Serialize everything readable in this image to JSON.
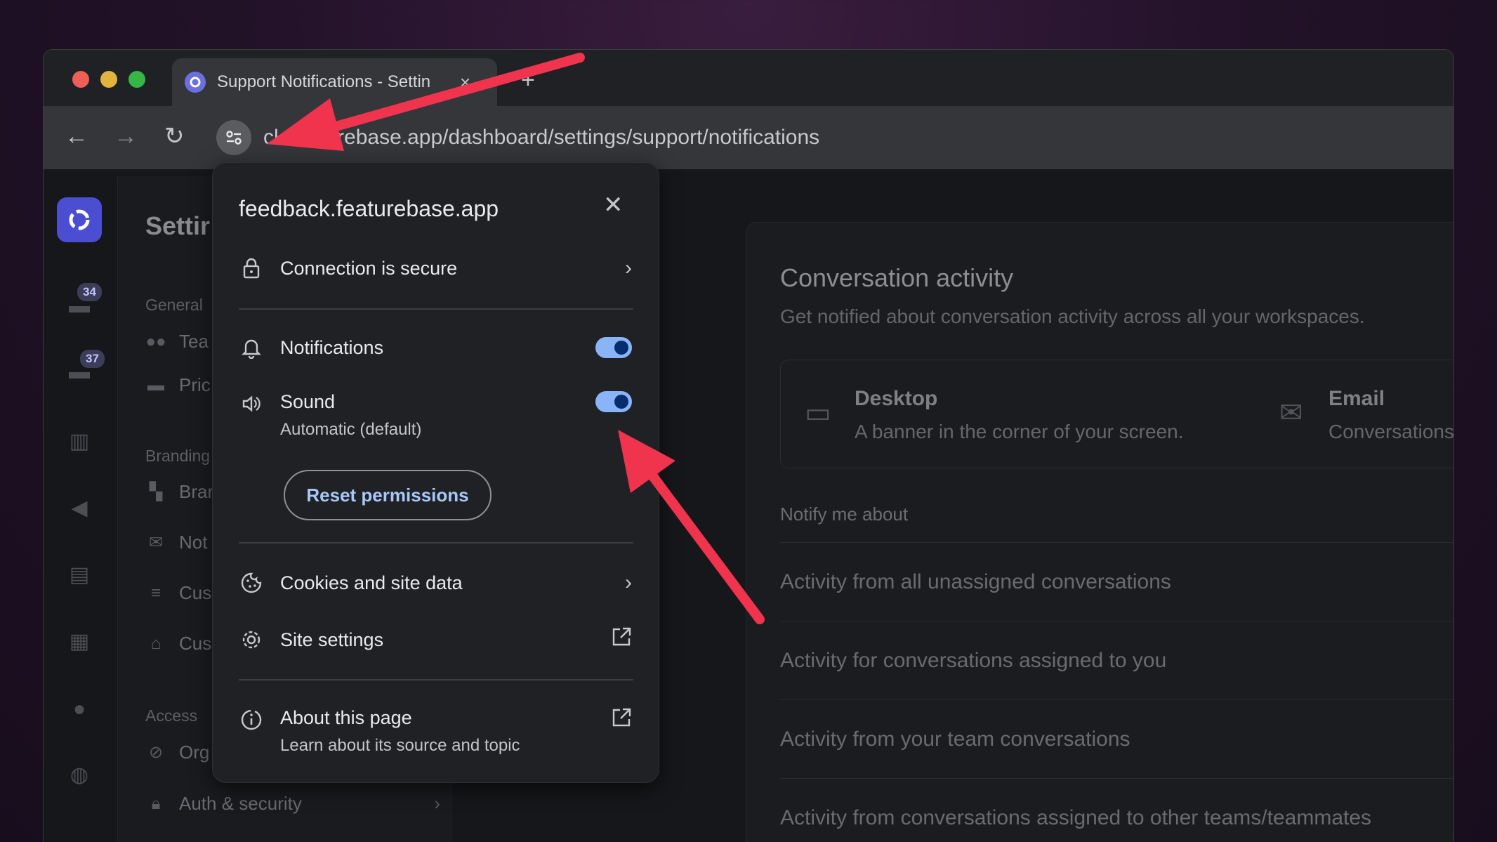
{
  "browser": {
    "tab_title": "Support Notifications - Settin",
    "tab_close": "×",
    "new_tab": "+",
    "url_visible": "ck.featurebase.app/dashboard/settings/support/notifications",
    "nav_back": "←",
    "nav_forward": "→",
    "reload": "↻"
  },
  "sidebar": {
    "badges": [
      "34",
      "37"
    ],
    "settings_title": "Settir",
    "groups": [
      {
        "label": "General",
        "items": [
          {
            "label": "Tea",
            "icon": "people-icon"
          },
          {
            "label": "Pric",
            "icon": "card-icon"
          }
        ]
      },
      {
        "label": "Branding",
        "items": [
          {
            "label": "Brar",
            "icon": "palette-icon"
          },
          {
            "label": "Not",
            "icon": "mail-icon"
          },
          {
            "label": "Cus",
            "icon": "menu-icon"
          },
          {
            "label": "Cus",
            "icon": "home-icon"
          }
        ]
      },
      {
        "label": "Access",
        "items": [
          {
            "label": "Org",
            "icon": "eye-off-icon"
          },
          {
            "label": "Auth & security",
            "icon": "lock-icon"
          }
        ]
      }
    ]
  },
  "content": {
    "title": "Conversation activity",
    "subtitle": "Get notified about conversation activity across all your workspaces.",
    "channels": [
      {
        "name": "Desktop",
        "description": "A banner in the corner of your screen.",
        "icon": "monitor-icon"
      },
      {
        "name": "Email",
        "description": "Conversations",
        "icon": "envelope-icon"
      }
    ],
    "notify_label": "Notify me about",
    "activities": [
      "Activity from all unassigned conversations",
      "Activity for conversations assigned to you",
      "Activity from your team conversations",
      "Activity from conversations assigned to other teams/teammates"
    ]
  },
  "popup": {
    "host": "feedback.featurebase.app",
    "close": "✕",
    "connection": "Connection is secure",
    "notifications": {
      "label": "Notifications",
      "enabled": true
    },
    "sound": {
      "label": "Sound",
      "sub": "Automatic (default)",
      "enabled": true
    },
    "reset_button": "Reset permissions",
    "cookies": "Cookies and site data",
    "site_settings": "Site settings",
    "about": {
      "label": "About this page",
      "sub": "Learn about its source and topic"
    }
  },
  "colors": {
    "accent": "#8ab4f8",
    "arrow": "#f0344e",
    "brand": "#4b4ed1"
  }
}
